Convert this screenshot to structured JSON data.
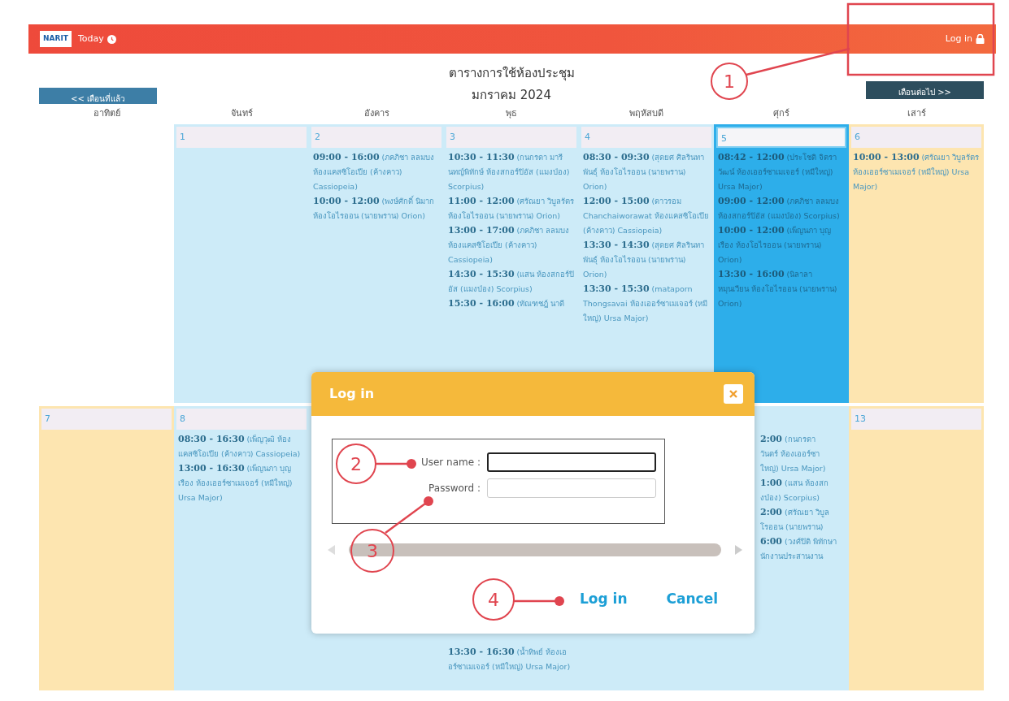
{
  "navbar": {
    "logo": "NARIT",
    "today": "Today",
    "login": "Log in"
  },
  "title": "ตารางการใช้ห้องประชุม",
  "month": "มกราคม 2024",
  "prev_button": "<< เดือนที่แล้ว",
  "next_button": "เดือนต่อไป >>",
  "weekdays": [
    "อาทิตย์",
    "จันทร์",
    "อังคาร",
    "พุธ",
    "พฤหัสบดี",
    "ศุกร์",
    "เสาร์"
  ],
  "weeks": [
    [
      {
        "kind": "blank"
      },
      {
        "kind": "weekday",
        "day": "1",
        "selected": false
      },
      {
        "kind": "weekday",
        "day": "2",
        "selected": false,
        "events": [
          {
            "time": "09:00 - 16:00",
            "detail": "(ภคภิชา ลลมบง ห้องแคสซิโอเปีย (ค้างคาว) Cassiopeia)"
          },
          {
            "time": "10:00 - 12:00",
            "detail": "(พงษ์ศักดิ์ นิมาก ห้องโอไรออน (นายพราน) Orion)"
          }
        ]
      },
      {
        "kind": "weekday",
        "day": "3",
        "selected": false,
        "events": [
          {
            "time": "10:30 - 11:30",
            "detail": "(กนกรดา มารีนทญ์พิทักษ์ ห้องสกอร์ปิอัส (แมงป่อง) Scorpius)"
          },
          {
            "time": "11:00 - 12:00",
            "detail": "(ศรัณยา วิบูลรัตร ห้องโอไรออน (นายพราน) Orion)"
          },
          {
            "time": "13:00 - 17:00",
            "detail": "(ภคภิชา ลลมบง ห้องแคสซิโอเปีย (ค้างคาว) Cassiopeia)"
          },
          {
            "time": "14:30 - 15:30",
            "detail": "(แสน ห้องสกอร์ปิอัส (แมงป่อง) Scorpius)"
          },
          {
            "time": "15:30 - 16:00",
            "detail": "(ทัณฑชฎ์ นาดี"
          }
        ]
      },
      {
        "kind": "weekday",
        "day": "4",
        "selected": false,
        "events": [
          {
            "time": "08:30 - 09:30",
            "detail": "(สุดยศ ศิลรินทาพันธุ์ ห้องโอไรออน (นายพราน) Orion)"
          },
          {
            "time": "12:00 - 15:00",
            "detail": "(ดาวรอม Chanchaiworawat ห้องแคสซิโอเปีย (ค้างคาว) Cassiopeia)"
          },
          {
            "time": "13:30 - 14:30",
            "detail": "(สุดยศ ศิลรินทาพันธุ์ ห้องโอไรออน (นายพราน) Orion)"
          },
          {
            "time": "13:30 - 15:30",
            "detail": "(mataporn Thongsavai ห้องเออร์ซาเมเจอร์ (หมีใหญ่) Ursa Major)"
          }
        ]
      },
      {
        "kind": "weekday",
        "day": "5",
        "selected": true,
        "events": [
          {
            "time": "08:42 - 12:00",
            "detail": "(ประโชติ จิตราวัฒน์ ห้องเออร์ซาเมเจอร์ (หมีใหญ่) Ursa Major)"
          },
          {
            "time": "09:00 - 12:00",
            "detail": "(ภคภิชา ลลมบง ห้องสกอร์ปิอัส (แมงป่อง) Scorpius)"
          },
          {
            "time": "10:00 - 12:00",
            "detail": "(เพ็ญนภา บุญเรือง ห้องโอไรออน (นายพราน) Orion)"
          },
          {
            "time": "13:30 - 16:00",
            "detail": "(นิลาลา หมุนเวียน ห้องโอไรออน (นายพราน) Orion)"
          }
        ]
      },
      {
        "kind": "weekend",
        "day": "6",
        "selected": false,
        "events": [
          {
            "time": "10:00 - 13:00",
            "detail": "(ศรัณยา วิบูลรัตร ห้องเออร์ซาเมเจอร์ (หมีใหญ่) Ursa Major)"
          }
        ]
      }
    ],
    [
      {
        "kind": "weekend",
        "day": "7",
        "selected": false
      },
      {
        "kind": "weekday",
        "day": "8",
        "selected": false,
        "events": [
          {
            "time": "08:30 - 16:30",
            "detail": "(เพ็ญวุฒิ ห้องแคสซิโอเปีย (ค้างคาว) Cassiopeia)"
          },
          {
            "time": "13:00 - 16:30",
            "detail": "(เพ็ญนภา บุญเรือง ห้องเออร์ซาเมเจอร์ (หมีใหญ่) Ursa Major)"
          }
        ]
      },
      {
        "kind": "covered",
        "selected": false
      },
      {
        "kind": "covered",
        "selected": false,
        "events": [
          {
            "time": "13:30 - 16:30",
            "detail": "(น้ำทิพย์ ห้องเออร์ซาเมเจอร์ (หมีใหญ่) Ursa Major)"
          }
        ]
      },
      {
        "kind": "covered",
        "selected": false
      },
      {
        "kind": "partial",
        "selected": false,
        "events": [
          {
            "time": "2:00",
            "lines": [
              "(กนกรดา",
              "วันตร์ ห้องเออร์ซา",
              "ใหญ่) Ursa Major)"
            ]
          },
          {
            "time": "1:00",
            "lines": [
              "(แสน ห้องสก",
              "งป่อง) Scorpius)"
            ]
          },
          {
            "time": "2:00",
            "lines": [
              "(ศรัณยา วิบูล",
              "โรออน (นายพราน)"
            ]
          },
          {
            "time": "6:00",
            "lines": [
              "(วงศ์ปิติ พิทักษา",
              "นักงานประสานงาน"
            ]
          }
        ]
      },
      {
        "kind": "weekend",
        "day": "13",
        "selected": false
      }
    ]
  ],
  "login_dialog": {
    "title": "Log in",
    "fields": [
      {
        "label": "User name :",
        "focused": true
      },
      {
        "label": "Password :",
        "focused": false
      }
    ],
    "buttons": [
      "Log in",
      "Cancel"
    ]
  },
  "annotations": [
    {
      "label": "1",
      "kind": "frame"
    },
    {
      "label": "2",
      "kind": "pointer"
    },
    {
      "label": "3",
      "kind": "pointer"
    },
    {
      "label": "4",
      "kind": "pointer"
    }
  ]
}
